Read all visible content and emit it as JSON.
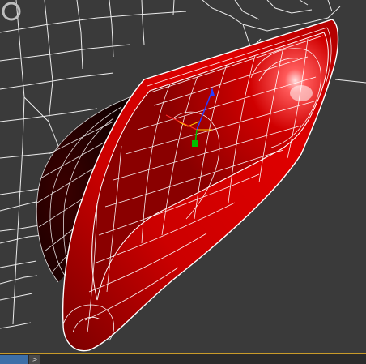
{
  "viewport": {
    "background_color": "#3a3a3a",
    "object_color": "#c80000",
    "wire_color": "#ffffff",
    "gizmo_axes": {
      "x_color": "#ff2a2a",
      "y_color": "#00c000",
      "z_color": "#2a3cff"
    }
  },
  "timeline": {
    "toggle_glyph": ">",
    "accent_color": "#3d6fa8",
    "frame_line_color": "#c89a2a"
  },
  "icons": {
    "viewcube": "viewcube-ring-icon",
    "timeline_toggle": "chevron-right-icon",
    "gizmo": "transform-gizmo-icon"
  }
}
